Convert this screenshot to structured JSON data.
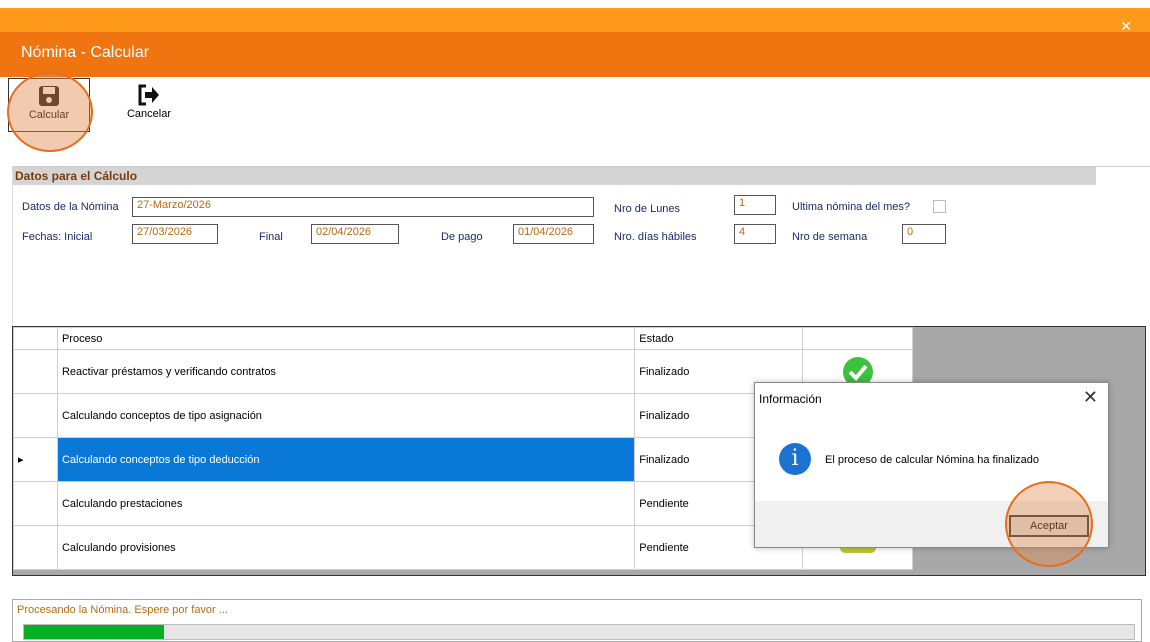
{
  "window": {
    "title": "Nómina - Calcular",
    "controls": "_ ✕"
  },
  "toolbar": {
    "calcular_label": "Calcular",
    "cancelar_label": "Cancelar",
    "calcular_icon": "save-icon",
    "cancelar_icon": "sign-out-icon"
  },
  "datos": {
    "header": "Datos para el Cálculo",
    "nomina_label": "Datos de la Nómina",
    "nomina_value": "27-Marzo/2026",
    "fechas_label": "Fechas:  Inicial",
    "inicial_value": "27/03/2026",
    "final_label": "Final",
    "final_value": "02/04/2026",
    "pago_label": "De pago",
    "pago_value": "01/04/2026",
    "lunes_label": "Nro de Lunes",
    "lunes_value": "1",
    "dias_label": "Nro. días hábiles",
    "dias_value": "4",
    "ultima_label": "Ultima nómina del mes?",
    "semana_label": "Nro de semana",
    "semana_value": "0"
  },
  "grid": {
    "headers": [
      "Proceso",
      "Estado"
    ],
    "rows": [
      {
        "proceso": "Reactivar préstamos y verificando contratos",
        "estado": "Finalizado"
      },
      {
        "proceso": "Calculando conceptos de tipo asignación",
        "estado": "Finalizado"
      },
      {
        "proceso": "Calculando conceptos de tipo deducción",
        "estado": "Finalizado"
      },
      {
        "proceso": "Calculando prestaciones",
        "estado": "Pendiente"
      },
      {
        "proceso": "Calculando provisiones",
        "estado": "Pendiente"
      }
    ],
    "row_marker": "▸"
  },
  "dialog": {
    "title": "Información",
    "message": "El proceso de calcular Nómina ha finalizado",
    "ok_label": "Aceptar",
    "close": "✕",
    "info_glyph": "i"
  },
  "progress": {
    "label": "Procesando la Nómina. Espere por favor ...",
    "fraction": 0.126
  },
  "colors": {
    "title_bar": "#f07410",
    "top_strip": "#ff9a1a",
    "selection": "#0a78d7",
    "progress": "#06b025",
    "check": "#3cc23c"
  }
}
